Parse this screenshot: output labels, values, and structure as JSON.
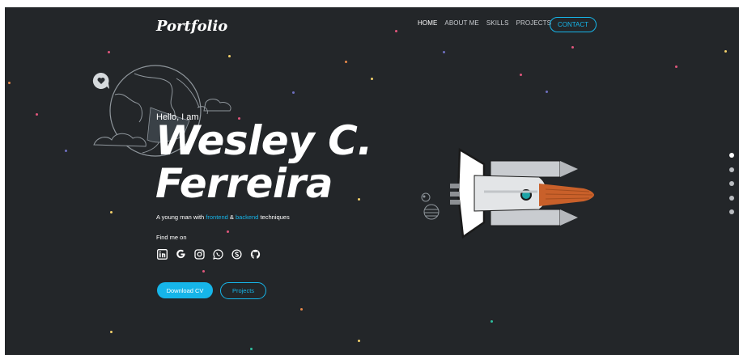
{
  "header": {
    "logo": "Portfolio",
    "nav": [
      "HOME",
      "ABOUT ME",
      "SKILLS",
      "PROJECTS"
    ],
    "contact": "CONTACT"
  },
  "hero": {
    "greeting": "Hello, I am",
    "name_line1": "Wesley C.",
    "name_line2": "Ferreira",
    "tagline_prefix": "A young man with ",
    "tagline_frontend": "frontend",
    "tagline_mid": " & ",
    "tagline_backend": "backend",
    "tagline_suffix": " techniques",
    "find_me": "Find me on",
    "socials": [
      "linkedin-icon",
      "google-icon",
      "instagram-icon",
      "whatsapp-icon",
      "skype-icon",
      "github-icon"
    ],
    "download_cv": "Download CV",
    "projects": "Projects"
  },
  "pagination": {
    "total": 5,
    "active": 1
  },
  "colors": {
    "background": "#232629",
    "accent": "#16b5e9",
    "rocket_flame": "#c9602a"
  }
}
